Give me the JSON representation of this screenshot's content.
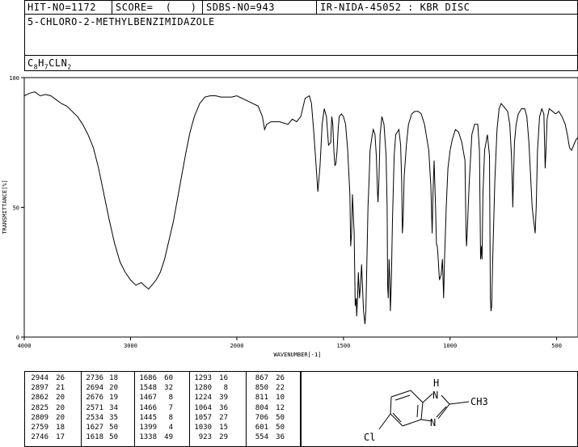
{
  "header": {
    "hit_no": "HIT-NO=1172",
    "score": "SCORE=  (   )",
    "sdbs_no": "SDBS-NO=943",
    "source": "IR-NIDA-45052 : KBR DISC",
    "compound": "5-CHLORO-2-METHYLBENZIMIDAZOLE",
    "formula_parts": [
      "C",
      "8",
      "H",
      "7",
      "CLN",
      "2"
    ]
  },
  "chart_data": {
    "type": "line",
    "title": "",
    "xlabel": "WAVENUMBER[-1]",
    "ylabel": "TRANSMITTANCE[%]",
    "xlim": [
      4000,
      400
    ],
    "ylim": [
      0,
      100
    ],
    "x_ticks": [
      4000,
      3000,
      2000,
      1500,
      1000,
      500
    ],
    "x_tick_labels": [
      "4000",
      "3000",
      "2000",
      "1500",
      "1000",
      "500"
    ],
    "y_ticks": [
      0,
      50,
      100
    ],
    "y_tick_labels": [
      "0",
      "50",
      "100"
    ],
    "grid": false,
    "series": [
      {
        "points": [
          [
            4000,
            93
          ],
          [
            3950,
            94
          ],
          [
            3900,
            94.5
          ],
          [
            3850,
            93
          ],
          [
            3800,
            93.5
          ],
          [
            3750,
            93
          ],
          [
            3700,
            91.5
          ],
          [
            3650,
            90
          ],
          [
            3600,
            89
          ],
          [
            3550,
            87
          ],
          [
            3500,
            85
          ],
          [
            3450,
            82
          ],
          [
            3400,
            78
          ],
          [
            3350,
            73
          ],
          [
            3300,
            65
          ],
          [
            3250,
            55
          ],
          [
            3200,
            45
          ],
          [
            3150,
            36
          ],
          [
            3100,
            29
          ],
          [
            3050,
            25
          ],
          [
            3000,
            22
          ],
          [
            2950,
            20
          ],
          [
            2900,
            21
          ],
          [
            2860,
            19.5
          ],
          [
            2830,
            18.5
          ],
          [
            2800,
            20
          ],
          [
            2760,
            22
          ],
          [
            2720,
            25
          ],
          [
            2680,
            30
          ],
          [
            2640,
            37
          ],
          [
            2600,
            44
          ],
          [
            2560,
            53
          ],
          [
            2520,
            62
          ],
          [
            2480,
            71
          ],
          [
            2440,
            79
          ],
          [
            2400,
            85
          ],
          [
            2350,
            90
          ],
          [
            2300,
            92.5
          ],
          [
            2250,
            93
          ],
          [
            2200,
            93
          ],
          [
            2150,
            92.5
          ],
          [
            2100,
            92.5
          ],
          [
            2050,
            92.5
          ],
          [
            2000,
            93
          ],
          [
            1950,
            91
          ],
          [
            1900,
            89
          ],
          [
            1880,
            85
          ],
          [
            1870,
            80
          ],
          [
            1860,
            82
          ],
          [
            1840,
            83
          ],
          [
            1800,
            83
          ],
          [
            1760,
            82
          ],
          [
            1740,
            84
          ],
          [
            1720,
            83
          ],
          [
            1700,
            85
          ],
          [
            1680,
            92
          ],
          [
            1660,
            93
          ],
          [
            1650,
            90
          ],
          [
            1640,
            80
          ],
          [
            1630,
            68
          ],
          [
            1620,
            56
          ],
          [
            1610,
            66
          ],
          [
            1600,
            82
          ],
          [
            1590,
            88
          ],
          [
            1580,
            85
          ],
          [
            1570,
            74
          ],
          [
            1560,
            75
          ],
          [
            1555,
            85
          ],
          [
            1550,
            82
          ],
          [
            1545,
            72
          ],
          [
            1540,
            66
          ],
          [
            1535,
            67
          ],
          [
            1530,
            72
          ],
          [
            1525,
            80
          ],
          [
            1520,
            85
          ],
          [
            1510,
            86
          ],
          [
            1500,
            85
          ],
          [
            1490,
            82
          ],
          [
            1480,
            72
          ],
          [
            1470,
            55
          ],
          [
            1466,
            35
          ],
          [
            1462,
            40
          ],
          [
            1458,
            55
          ],
          [
            1450,
            40
          ],
          [
            1445,
            12
          ],
          [
            1440,
            15
          ],
          [
            1438,
            8
          ],
          [
            1434,
            15
          ],
          [
            1430,
            25
          ],
          [
            1425,
            15
          ],
          [
            1420,
            20
          ],
          [
            1415,
            28
          ],
          [
            1410,
            18
          ],
          [
            1406,
            10
          ],
          [
            1399,
            5
          ],
          [
            1395,
            10
          ],
          [
            1390,
            30
          ],
          [
            1385,
            50
          ],
          [
            1380,
            60
          ],
          [
            1375,
            72
          ],
          [
            1365,
            78
          ],
          [
            1360,
            80
          ],
          [
            1352,
            78
          ],
          [
            1346,
            70
          ],
          [
            1340,
            55
          ],
          [
            1338,
            52
          ],
          [
            1334,
            60
          ],
          [
            1328,
            78
          ],
          [
            1320,
            85
          ],
          [
            1310,
            82
          ],
          [
            1300,
            70
          ],
          [
            1295,
            50
          ],
          [
            1293,
            20
          ],
          [
            1290,
            15
          ],
          [
            1286,
            30
          ],
          [
            1282,
            20
          ],
          [
            1280,
            10
          ],
          [
            1276,
            20
          ],
          [
            1270,
            45
          ],
          [
            1262,
            70
          ],
          [
            1255,
            78
          ],
          [
            1240,
            80
          ],
          [
            1232,
            74
          ],
          [
            1227,
            60
          ],
          [
            1224,
            40
          ],
          [
            1220,
            45
          ],
          [
            1215,
            62
          ],
          [
            1205,
            74
          ],
          [
            1195,
            82
          ],
          [
            1180,
            86
          ],
          [
            1165,
            87
          ],
          [
            1150,
            87
          ],
          [
            1135,
            86
          ],
          [
            1120,
            82
          ],
          [
            1100,
            72
          ],
          [
            1090,
            58
          ],
          [
            1084,
            40
          ],
          [
            1080,
            55
          ],
          [
            1075,
            68
          ],
          [
            1068,
            50
          ],
          [
            1064,
            36
          ],
          [
            1060,
            35
          ],
          [
            1057,
            32
          ],
          [
            1050,
            22
          ],
          [
            1042,
            24
          ],
          [
            1036,
            30
          ],
          [
            1032,
            20
          ],
          [
            1030,
            15
          ],
          [
            1026,
            30
          ],
          [
            1018,
            50
          ],
          [
            1010,
            65
          ],
          [
            1000,
            72
          ],
          [
            990,
            76
          ],
          [
            975,
            80
          ],
          [
            960,
            79
          ],
          [
            945,
            75
          ],
          [
            930,
            68
          ],
          [
            925,
            40
          ],
          [
            923,
            35
          ],
          [
            920,
            40
          ],
          [
            910,
            60
          ],
          [
            898,
            78
          ],
          [
            885,
            82
          ],
          [
            870,
            82
          ],
          [
            862,
            72
          ],
          [
            857,
            30
          ],
          [
            853,
            35
          ],
          [
            850,
            30
          ],
          [
            846,
            55
          ],
          [
            838,
            72
          ],
          [
            825,
            78
          ],
          [
            815,
            70
          ],
          [
            811,
            15
          ],
          [
            808,
            10
          ],
          [
            805,
            12
          ],
          [
            800,
            30
          ],
          [
            790,
            60
          ],
          [
            780,
            80
          ],
          [
            770,
            88
          ],
          [
            760,
            90
          ],
          [
            750,
            89
          ],
          [
            740,
            88
          ],
          [
            730,
            87
          ],
          [
            720,
            82
          ],
          [
            712,
            70
          ],
          [
            708,
            58
          ],
          [
            706,
            50
          ],
          [
            703,
            60
          ],
          [
            698,
            75
          ],
          [
            690,
            82
          ],
          [
            680,
            86
          ],
          [
            665,
            88
          ],
          [
            650,
            88
          ],
          [
            640,
            85
          ],
          [
            630,
            75
          ],
          [
            615,
            50
          ],
          [
            608,
            45
          ],
          [
            601,
            40
          ],
          [
            596,
            50
          ],
          [
            590,
            72
          ],
          [
            580,
            85
          ],
          [
            570,
            88
          ],
          [
            560,
            86
          ],
          [
            554,
            65
          ],
          [
            550,
            72
          ],
          [
            545,
            84
          ],
          [
            535,
            88
          ],
          [
            520,
            87
          ],
          [
            505,
            86
          ],
          [
            490,
            87
          ],
          [
            475,
            85
          ],
          [
            460,
            82
          ],
          [
            450,
            78
          ],
          [
            440,
            73
          ],
          [
            430,
            72
          ],
          [
            420,
            74
          ],
          [
            410,
            76
          ],
          [
            400,
            77
          ]
        ]
      }
    ]
  },
  "peaks": {
    "columns": [
      [
        [
          "2944",
          "26"
        ],
        [
          "2897",
          "21"
        ],
        [
          "2862",
          "20"
        ],
        [
          "2825",
          "20"
        ],
        [
          "2809",
          "20"
        ],
        [
          "2759",
          "18"
        ],
        [
          "2746",
          "17"
        ]
      ],
      [
        [
          "2736",
          "18"
        ],
        [
          "2694",
          "20"
        ],
        [
          "2676",
          "19"
        ],
        [
          "2571",
          "34"
        ],
        [
          "2534",
          "35"
        ],
        [
          "1627",
          "50"
        ],
        [
          "1618",
          "50"
        ]
      ],
      [
        [
          "1686",
          "60"
        ],
        [
          "1548",
          "32"
        ],
        [
          "1467",
          "8"
        ],
        [
          "1466",
          "7"
        ],
        [
          "1445",
          "8"
        ],
        [
          "1399",
          "4"
        ],
        [
          "1338",
          "49"
        ]
      ],
      [
        [
          "1293",
          "16"
        ],
        [
          "1280",
          "8"
        ],
        [
          "1224",
          "39"
        ],
        [
          "1064",
          "36"
        ],
        [
          "1057",
          "27"
        ],
        [
          "1030",
          "15"
        ],
        [
          "923",
          "29"
        ]
      ],
      [
        [
          "867",
          "26"
        ],
        [
          "850",
          "22"
        ],
        [
          "811",
          "10"
        ],
        [
          "804",
          "12"
        ],
        [
          "706",
          "50"
        ],
        [
          "601",
          "50"
        ],
        [
          "554",
          "36"
        ]
      ]
    ]
  },
  "structure": {
    "nh_label": "H",
    "n_label": "N",
    "methyl_label": "CH3",
    "chloro_label": "Cl"
  }
}
